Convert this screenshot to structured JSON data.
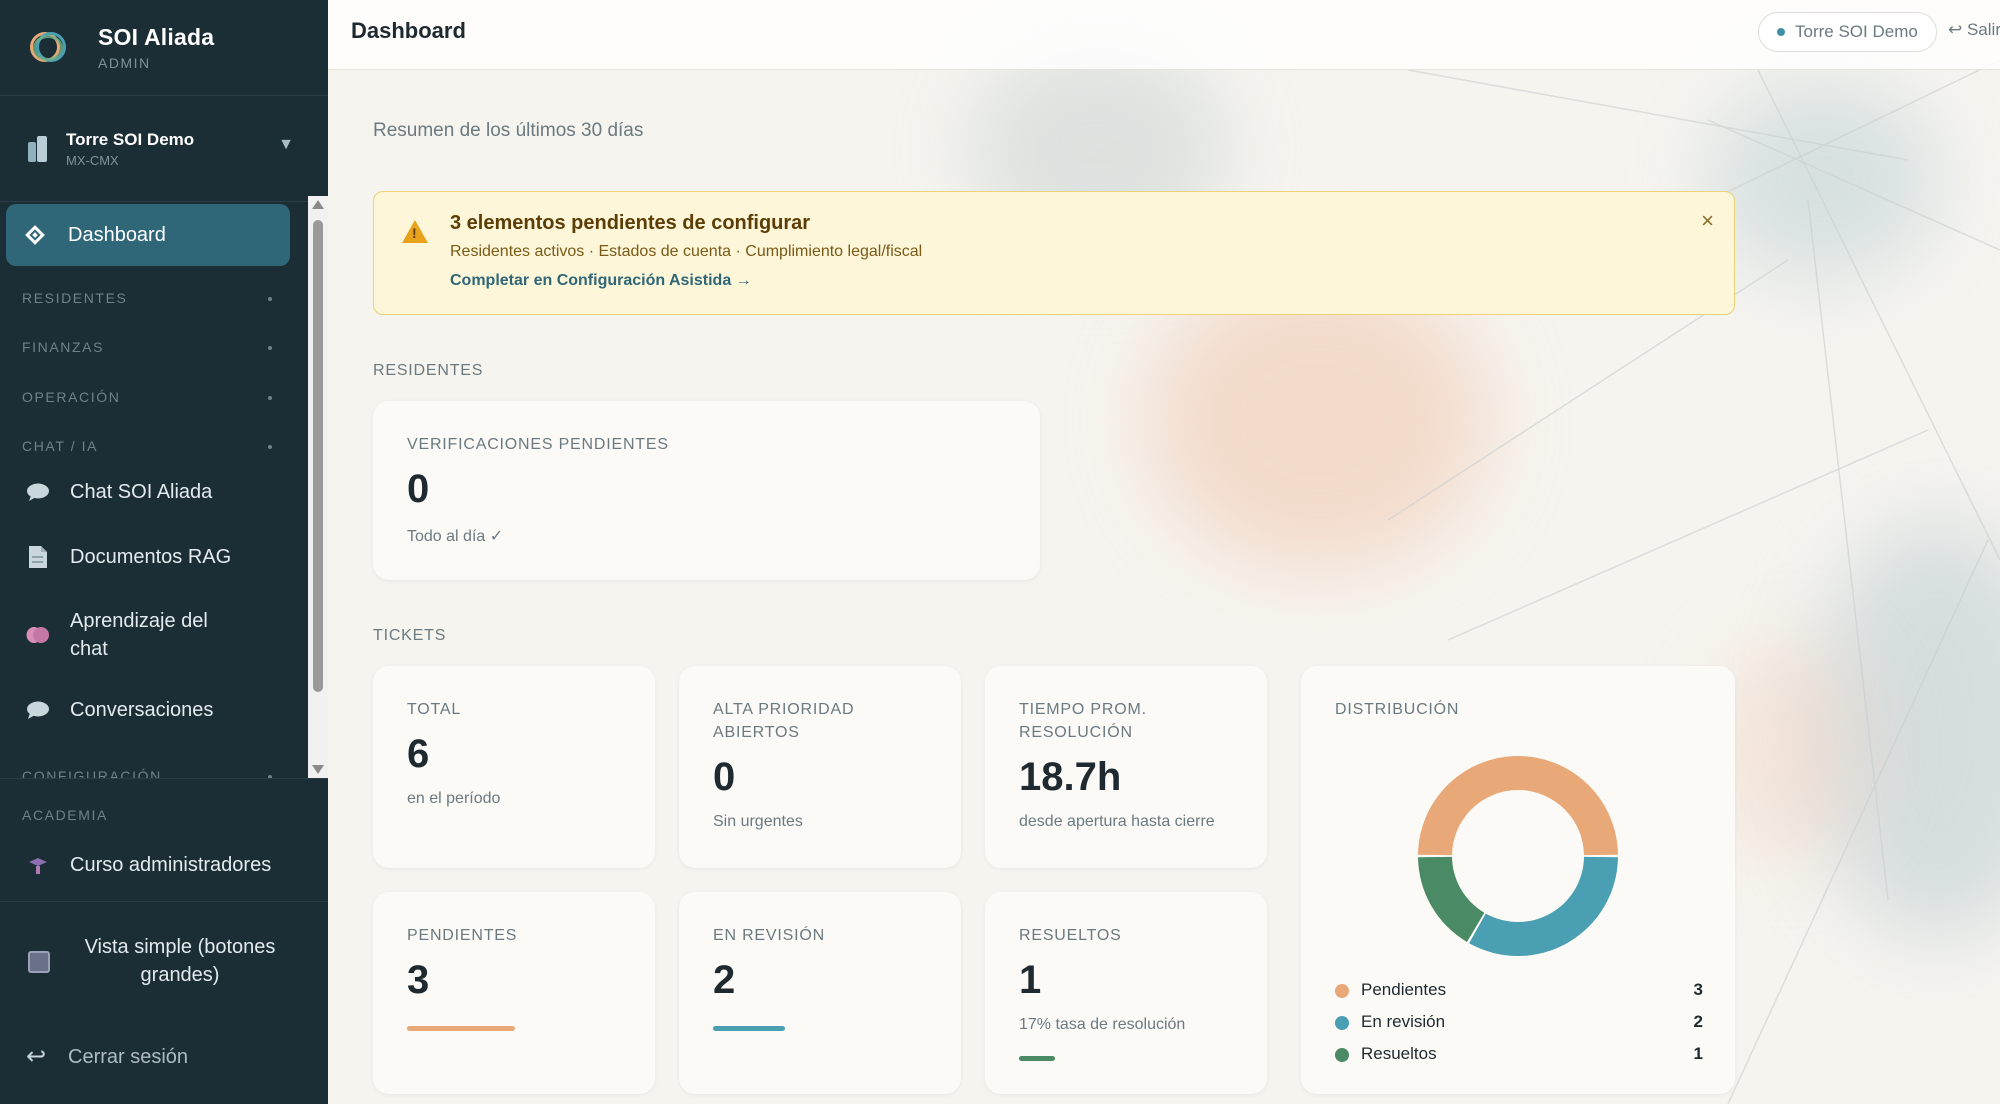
{
  "sidebar": {
    "brand": {
      "name": "SOI Aliada",
      "role": "ADMIN"
    },
    "tower": {
      "name": "Torre SOI Demo",
      "code": "MX-CMX"
    },
    "active": {
      "label": "Dashboard",
      "icon": "diamond-icon"
    },
    "sections": [
      "RESIDENTES",
      "FINANZAS",
      "OPERACIÓN",
      "CHAT / IA",
      "CONFIGURACIÓN"
    ],
    "chat_items": [
      {
        "label": "Chat SOI Aliada",
        "icon": "chat-bubble-icon"
      },
      {
        "label": "Documentos RAG",
        "icon": "document-icon"
      },
      {
        "label": "Aprendizaje del chat",
        "icon": "brain-icon"
      },
      {
        "label": "Conversaciones",
        "icon": "speech-bubble-icon"
      }
    ],
    "academy": {
      "section": "ACADEMIA",
      "item": "Curso administradores",
      "icon": "graduation-cap-icon"
    },
    "simple_view": {
      "label": "Vista simple (botones grandes)",
      "icon": "square-icon"
    },
    "logout": {
      "label": "Cerrar sesión",
      "icon": "logout-arrow-icon"
    }
  },
  "topbar": {
    "title": "Dashboard",
    "tower_pill": "Torre SOI Demo",
    "logout": "↩ Salir"
  },
  "subtitle": "Resumen de los últimos 30 días",
  "alert": {
    "title": "3 elementos pendientes de configurar",
    "detail": "Residentes activos · Estados de cuenta · Cumplimiento legal/fiscal",
    "link": "Completar en Configuración Asistida →",
    "close": "×"
  },
  "residentes": {
    "section": "RESIDENTES",
    "card": {
      "label": "VERIFICACIONES PENDIENTES",
      "value": "0",
      "sub": "Todo al día ✓"
    }
  },
  "tickets": {
    "section": "TICKETS",
    "total": {
      "label": "TOTAL",
      "value": "6",
      "sub": "en el período"
    },
    "alta": {
      "label": "ALTA PRIORIDAD ABIERTOS",
      "value": "0",
      "sub": "Sin urgentes"
    },
    "tiempo": {
      "label": "TIEMPO PROM. RESOLUCIÓN",
      "value": "18.7h",
      "sub": "desde apertura hasta cierre"
    },
    "pendientes": {
      "label": "PENDIENTES",
      "value": "3"
    },
    "revision": {
      "label": "EN REVISIÓN",
      "value": "2"
    },
    "resueltos": {
      "label": "RESUELTOS",
      "value": "1",
      "sub": "17% tasa de resolución"
    }
  },
  "colors": {
    "pendientes": "#e9a877",
    "revision": "#4a9fb3",
    "resueltos": "#4a8a64",
    "accent": "#2f6778"
  },
  "chart_data": {
    "type": "pie",
    "title": "DISTRIBUCIÓN",
    "categories": [
      "Pendientes",
      "En revisión",
      "Resueltos"
    ],
    "values": [
      3,
      2,
      1
    ],
    "legend": "bottom"
  }
}
